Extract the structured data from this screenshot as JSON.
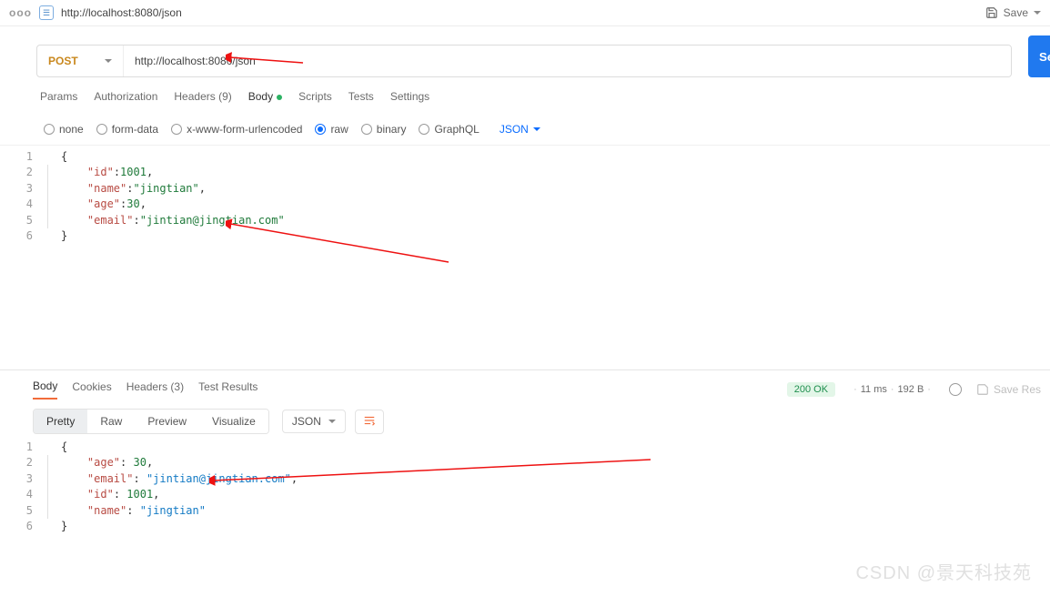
{
  "tab": {
    "title": "http://localhost:8080/json"
  },
  "topbar": {
    "save": "Save"
  },
  "request": {
    "method": "POST",
    "url": "http://localhost:8080/json",
    "send": "Send",
    "tabs": {
      "params": "Params",
      "auth": "Authorization",
      "headers": "Headers (9)",
      "body": "Body",
      "scripts": "Scripts",
      "tests": "Tests",
      "settings": "Settings"
    },
    "body_types": {
      "none": "none",
      "form_data": "form-data",
      "urlencoded": "x-www-form-urlencoded",
      "raw": "raw",
      "binary": "binary",
      "graphql": "GraphQL",
      "json": "JSON"
    },
    "editor_lines": [
      "1",
      "2",
      "3",
      "4",
      "5",
      "6"
    ],
    "json": {
      "id": 1001,
      "name": "jingtian",
      "age": 30,
      "email": "jintian@jingtian.com"
    }
  },
  "response": {
    "tabs": {
      "body": "Body",
      "cookies": "Cookies",
      "headers": "Headers (3)",
      "tests": "Test Results"
    },
    "status": "200 OK",
    "time": "11 ms",
    "size": "192 B",
    "save": "Save Res",
    "view": {
      "pretty": "Pretty",
      "raw": "Raw",
      "preview": "Preview",
      "visualize": "Visualize",
      "format": "JSON"
    },
    "editor_lines": [
      "1",
      "2",
      "3",
      "4",
      "5",
      "6"
    ],
    "json": {
      "age": 30,
      "email": "jintian@jingtian.com",
      "id": 1001,
      "name": "jingtian"
    }
  },
  "watermark": "CSDN @景天科技苑"
}
